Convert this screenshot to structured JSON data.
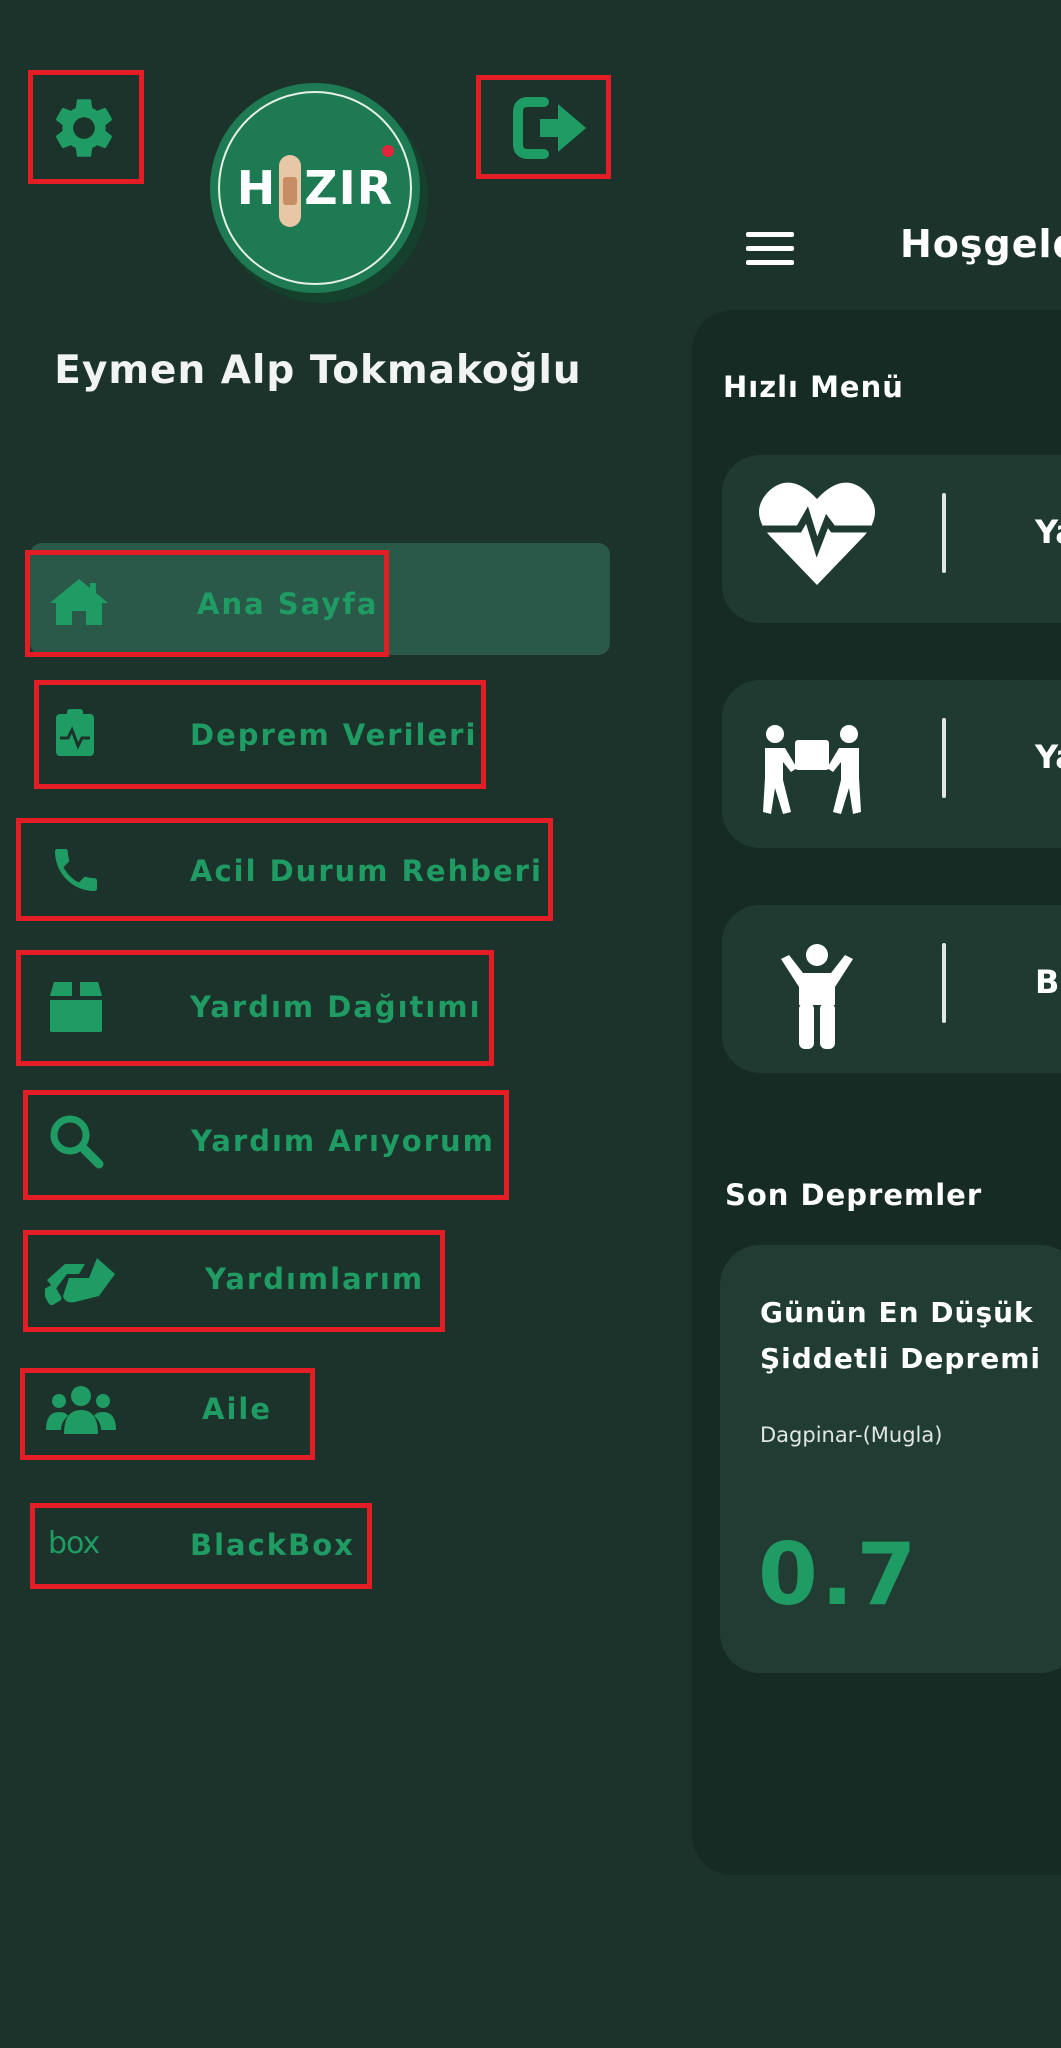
{
  "user": {
    "name": "Eymen Alp Tokmakoğlu"
  },
  "logo": {
    "left": "H",
    "right": "ZIR"
  },
  "menu": {
    "items": [
      {
        "label": "Ana Sayfa",
        "icon": "home-icon",
        "active": true
      },
      {
        "label": "Deprem Verileri",
        "icon": "clipboard-pulse-icon"
      },
      {
        "label": "Acil Durum Rehberi",
        "icon": "phone-icon"
      },
      {
        "label": "Yardım Dağıtımı",
        "icon": "box-icon"
      },
      {
        "label": "Yardım Arıyorum",
        "icon": "search-icon"
      },
      {
        "label": "Yardımlarım",
        "icon": "handshake-icon"
      },
      {
        "label": "Aile",
        "icon": "family-icon"
      },
      {
        "label": "BlackBox",
        "icon": "box-logo-icon",
        "icon_text": "box"
      }
    ]
  },
  "header": {
    "title": "Hoşgeld"
  },
  "quick_menu": {
    "title": "Hızlı Menü",
    "cards": [
      {
        "label": "Ya",
        "icon": "heart-pulse-icon"
      },
      {
        "label": "Ya",
        "icon": "people-carry-icon"
      },
      {
        "label": "B",
        "icon": "child-icon"
      }
    ]
  },
  "recent_quakes": {
    "title": "Son Depremler",
    "card": {
      "title_line1": "Günün En Düşük",
      "title_line2": "Şiddetli Depremi",
      "location": "Dagpinar-(Mugla)",
      "magnitude": "0.7"
    }
  },
  "colors": {
    "background": "#1c332b",
    "accent_green": "#1f9b64",
    "highlight_red": "#e21d26",
    "active_item": "#2b5949"
  }
}
